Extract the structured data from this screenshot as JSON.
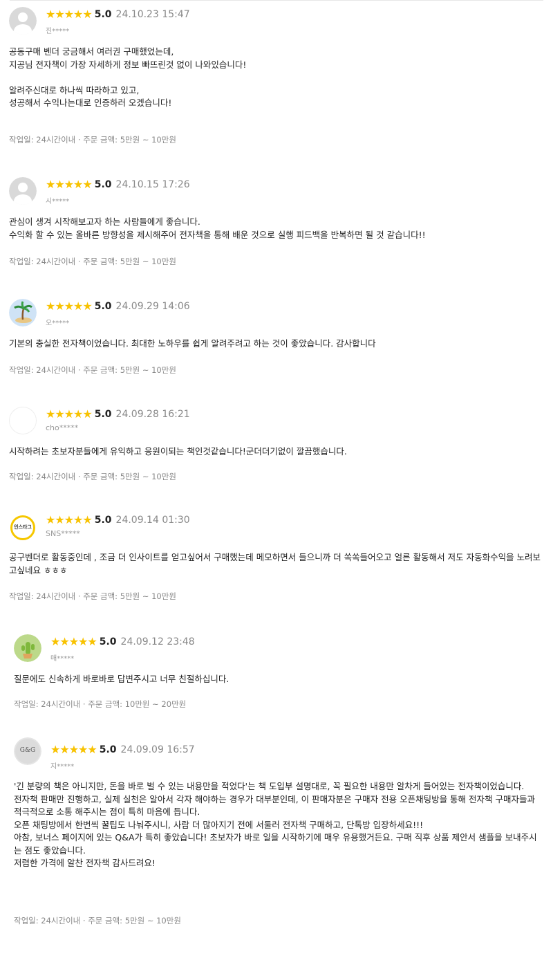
{
  "reviews": [
    {
      "avatar": "default-profile",
      "stars": "★★★★★",
      "score": "5.0",
      "date": "24.10.23 15:47",
      "user": "진*****",
      "paragraphs": [
        "공동구매 벤더 궁금해서 여러권 구매했었는데,",
        "지공님 전자책이 가장 자세하게 정보 빠뜨린것 없이 나와있습니다!",
        "",
        "알려주신대로 하나씩 따라하고 있고,",
        "성공해서 수익나는대로 인증하러 오겠습니다!"
      ],
      "info": "작업일: 24시간이내 · 주문 금액: 5만원 ~ 10만원"
    },
    {
      "avatar": "default-profile",
      "stars": "★★★★★",
      "score": "5.0",
      "date": "24.10.15 17:26",
      "user": "시*****",
      "paragraphs": [
        "관심이 생겨 시작해보고자 하는 사람들에게 좋습니다.",
        "수익화 할 수 있는 올바른 방향성을 제시해주어 전자책을 통해 배운 것으로 실행 피드백을 반복하면 될 것 같습니다!!"
      ],
      "info": "작업일: 24시간이내 · 주문 금액: 5만원 ~ 10만원"
    },
    {
      "avatar": "palm-tree",
      "stars": "★★★★★",
      "score": "5.0",
      "date": "24.09.29 14:06",
      "user": "오*****",
      "paragraphs": [
        "기본의 충실한 전자책이었습니다. 최대한 노하우를 쉽게 알려주려고 하는 것이 좋았습니다. 감사합니다"
      ],
      "info": "작업일: 24시간이내 · 주문 금액: 5만원 ~ 10만원"
    },
    {
      "avatar": "blank",
      "stars": "★★★★★",
      "score": "5.0",
      "date": "24.09.28 16:21",
      "user": "cho*****",
      "paragraphs": [
        "시작하려는 초보자분들에게 유익하고 응원이되는 책인것같습니다!군더더기없이 깔끔했습니다."
      ],
      "info": "작업일: 24시간이내 · 주문 금액: 5만원 ~ 10만원"
    },
    {
      "avatar": "instagram-badge",
      "avatar_text": "인스타그",
      "stars": "★★★★★",
      "score": "5.0",
      "date": "24.09.14 01:30",
      "user": "SNS*****",
      "paragraphs": [
        "공구벤더로 활동중인데 , 조금 더 인사이트를 얻고싶어서 구매했는데 메모하면서 들으니까 더 쏙쏙들어오고 얼른 활동해서 저도 자동화수익을 노려보고싶네요 ㅎㅎㅎ"
      ],
      "info": "작업일: 24시간이내 · 주문 금액: 5만원 ~ 10만원"
    },
    {
      "avatar": "cactus",
      "stars": "★★★★★",
      "score": "5.0",
      "date": "24.09.12 23:48",
      "user": "매*****",
      "paragraphs": [
        "질문에도 신속하게 바로바로 답변주시고 너무 친절하십니다."
      ],
      "info": "작업일: 24시간이내 · 주문 금액: 10만원 ~ 20만원"
    },
    {
      "avatar": "gg-logo",
      "avatar_text": "G&G",
      "stars": "★★★★★",
      "score": "5.0",
      "date": "24.09.09 16:57",
      "user": "지*****",
      "paragraphs": [
        "'긴 분량의 책은 아니지만, 돈을 바로 벌 수 있는 내용만을 적었다'는 책 도입부 설명대로, 꼭 필요한 내용만 알차게 들어있는 전자책이었습니다.",
        "전자책 판매만 진행하고, 실제 실천은 알아서 각자 해야하는 경우가 대부분인데, 이 판매자분은 구매자 전용 오픈채팅방을 통해 전자책 구매자들과 적극적으로 소통 해주시는 점이 특히 마음에 듭니다.",
        "오픈 채팅방에서 한번씩 꿀팁도 나눠주시니, 사람 더 많아지기 전에 서둘러 전자책 구매하고, 단톡방 입장하세요!!!",
        "아참, 보너스 페이지에 있는 Q&A가 특히 좋았습니다! 초보자가 바로 일을 시작하기에 매우 유용했거든요. 구매 직후 상품 제안서 샘플을 보내주시는 점도 좋았습니다.",
        "저렴한 가격에 알찬 전자책 감사드려요!"
      ],
      "info": "작업일: 24시간이내 · 주문 금액: 5만원 ~ 10만원"
    }
  ]
}
